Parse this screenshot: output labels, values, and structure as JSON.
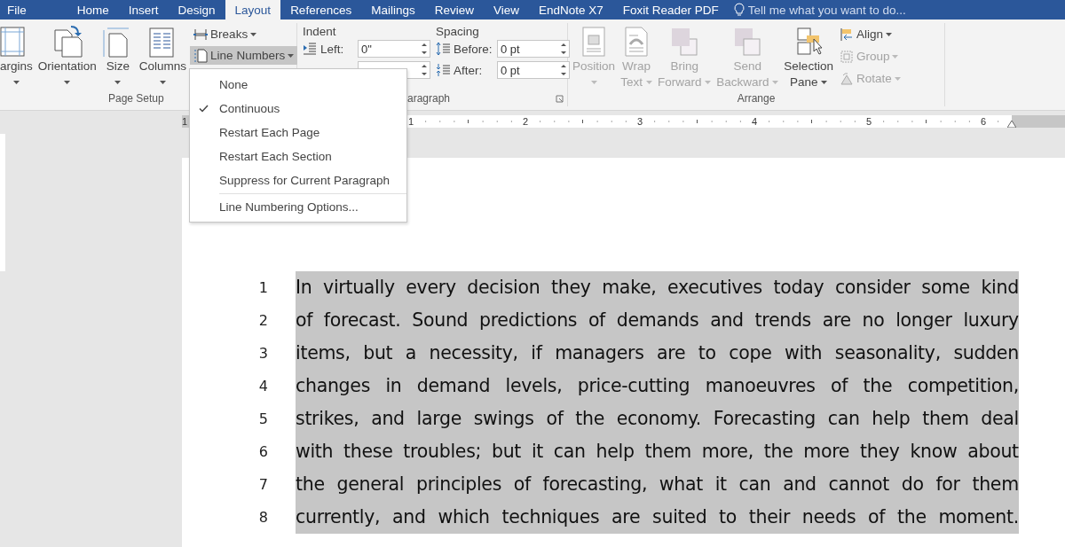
{
  "tabs": [
    {
      "label": "File",
      "selected": false
    },
    {
      "label": "Home",
      "selected": false
    },
    {
      "label": "Insert",
      "selected": false
    },
    {
      "label": "Design",
      "selected": false
    },
    {
      "label": "Layout",
      "selected": true
    },
    {
      "label": "References",
      "selected": false
    },
    {
      "label": "Mailings",
      "selected": false
    },
    {
      "label": "Review",
      "selected": false
    },
    {
      "label": "View",
      "selected": false
    },
    {
      "label": "EndNote X7",
      "selected": false
    },
    {
      "label": "Foxit Reader PDF",
      "selected": false
    }
  ],
  "tell_me": {
    "placeholder": "Tell me what you want to do..."
  },
  "page_setup": {
    "label": "Page Setup",
    "large_buttons": [
      {
        "lines": [
          "argins"
        ],
        "kind": "margins"
      },
      {
        "lines": [
          "Orientation"
        ],
        "kind": "orientation"
      },
      {
        "lines": [
          "Size"
        ],
        "kind": "size"
      },
      {
        "lines": [
          "Columns"
        ],
        "kind": "columns"
      }
    ],
    "small_buttons": [
      {
        "label": "Breaks",
        "kind": "breaks",
        "active": false
      },
      {
        "label": "Line Numbers",
        "kind": "line-numbers",
        "active": true
      }
    ]
  },
  "paragraph": {
    "label": "aragraph",
    "indent_label": "Indent",
    "left": {
      "label": "Left:",
      "value": "0\""
    },
    "spacing_label": "Spacing",
    "before": {
      "label": "Before:",
      "value": "0 pt"
    },
    "after": {
      "label": "After:",
      "value": "0 pt"
    }
  },
  "arrange": {
    "label": "Arrange",
    "large_buttons": [
      {
        "lines": [
          "Position"
        ],
        "kind": "position",
        "disabled": true
      },
      {
        "lines": [
          "Wrap",
          "Text"
        ],
        "kind": "wrap",
        "disabled": true
      },
      {
        "lines": [
          "Bring",
          "Forward"
        ],
        "kind": "forward",
        "disabled": true
      },
      {
        "lines": [
          "Send",
          "Backward"
        ],
        "kind": "backward",
        "disabled": true
      },
      {
        "lines": [
          "Selection",
          "Pane"
        ],
        "kind": "selection",
        "disabled": false
      }
    ],
    "small_buttons": [
      {
        "label": "Align",
        "kind": "align",
        "disabled": false
      },
      {
        "label": "Group",
        "kind": "group",
        "disabled": true
      },
      {
        "label": "Rotate",
        "kind": "rotate",
        "disabled": true
      }
    ]
  },
  "ruler": {
    "numbers": [
      "1",
      "1",
      "2",
      "3",
      "4",
      "5",
      "6"
    ]
  },
  "menu": {
    "items": [
      {
        "label": "None",
        "kind": "choice",
        "checked": false
      },
      {
        "label": "Continuous",
        "kind": "choice",
        "checked": true
      },
      {
        "label": "Restart Each Page",
        "kind": "choice",
        "checked": false
      },
      {
        "label": "Restart Each Section",
        "kind": "choice",
        "checked": false
      },
      {
        "label": "Suppress for Current Paragraph",
        "kind": "choice",
        "checked": false
      },
      {
        "label": "Line Numbering Options...",
        "kind": "command"
      }
    ]
  },
  "document": {
    "selected": true,
    "lines": [
      {
        "number": "1",
        "text": "In virtually every decision they make, executives today consider some kind"
      },
      {
        "number": "2",
        "text": "of forecast. Sound predictions of demands and trends are no longer luxury"
      },
      {
        "number": "3",
        "text": "items, but a necessity, if managers are to cope with seasonality, sudden"
      },
      {
        "number": "4",
        "text": "changes in demand levels, price-cutting manoeuvres of the competition,"
      },
      {
        "number": "5",
        "text": "strikes, and large swings of the economy. Forecasting can help them deal"
      },
      {
        "number": "6",
        "text": "with these troubles; but it can help them more, the more they know about"
      },
      {
        "number": "7",
        "text": "the general principles of forecasting, what it can and cannot do for them"
      },
      {
        "number": "8",
        "text": "currently, and which techniques are suited to their needs of the moment."
      }
    ]
  }
}
